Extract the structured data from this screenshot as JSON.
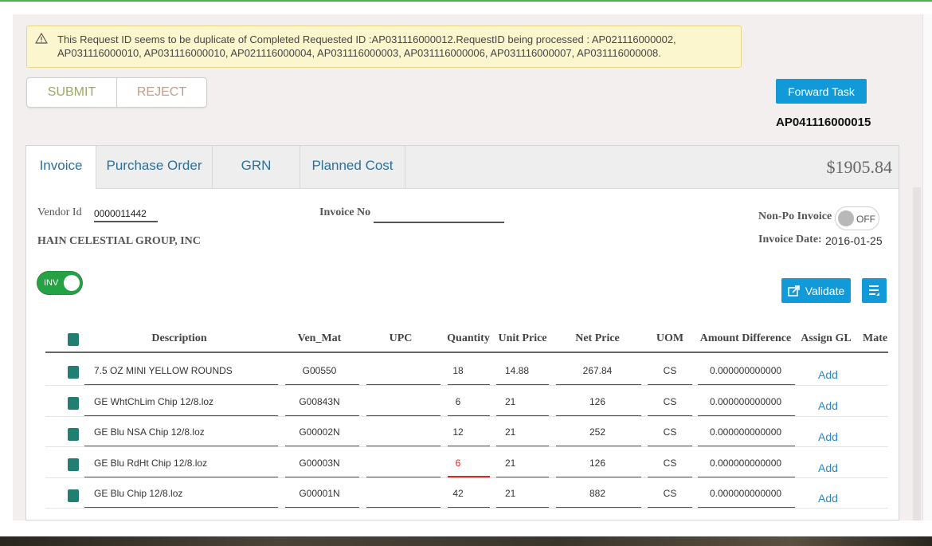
{
  "alert": {
    "icon": "warning-icon",
    "line1": "This Request ID seems to be duplicate of Completed Requested ID :AP031116000012.RequestID being processed : AP021116000002,",
    "line2": "AP031116000010, AP031116000010, AP021116000004, AP031116000003, AP031116000006, AP031116000007, AP031116000008."
  },
  "actions": {
    "submit": "SUBMIT",
    "reject": "REJECT",
    "forward": "Forward Task"
  },
  "request_id": "AP041116000015",
  "tabs": [
    {
      "label": "Invoice"
    },
    {
      "label": "Purchase Order"
    },
    {
      "label": "GRN"
    },
    {
      "label": "Planned Cost"
    }
  ],
  "total": "$1905.84",
  "invoice": {
    "vendor_id_label": "Vendor Id",
    "vendor_id": "0000011442",
    "invoice_no_label": "Invoice No",
    "vendor_name": "HAIN CELESTIAL GROUP, INC",
    "non_po_label": "Non-Po Invoice",
    "non_po_state": "OFF",
    "invoice_date_label": "Invoice Date:",
    "invoice_date": "2016-01-25",
    "inv_toggle": "INV",
    "validate": "Validate"
  },
  "table": {
    "headers": {
      "description": "Description",
      "ven_mat": "Ven_Mat",
      "upc": "UPC",
      "quantity": "Quantity",
      "unit_price": "Unit Price",
      "net_price": "Net Price",
      "uom": "UOM",
      "amount_difference": "Amount Difference",
      "assign_gl": "Assign GL",
      "mate": "Mate"
    },
    "rows": [
      {
        "description": "7.5 OZ MINI YELLOW ROUNDS",
        "ven_mat": "G00550",
        "upc": "",
        "quantity": "18",
        "unit_price": "14.88",
        "net_price": "267.84",
        "uom": "CS",
        "amount_difference": "0.000000000000",
        "assign_gl": "Add"
      },
      {
        "description": "GE WhtChLim Chip 12/8.loz",
        "ven_mat": "G00843N",
        "upc": "",
        "quantity": "6",
        "unit_price": "21",
        "net_price": "126",
        "uom": "CS",
        "amount_difference": "0.000000000000",
        "assign_gl": "Add"
      },
      {
        "description": "GE Blu NSA Chip 12/8.loz",
        "ven_mat": "G00002N",
        "upc": "",
        "quantity": "12",
        "unit_price": "21",
        "net_price": "252",
        "uom": "CS",
        "amount_difference": "0.000000000000",
        "assign_gl": "Add"
      },
      {
        "description": "GE Blu RdHt Chip 12/8.loz",
        "ven_mat": "G00003N",
        "upc": "",
        "quantity": "6",
        "unit_price": "21",
        "net_price": "126",
        "uom": "CS",
        "amount_difference": "0.000000000000",
        "assign_gl": "Add"
      },
      {
        "description": "GE Blu Chip 12/8.loz",
        "ven_mat": "G00001N",
        "upc": "",
        "quantity": "42",
        "unit_price": "21",
        "net_price": "882",
        "uom": "CS",
        "amount_difference": "0.000000000000",
        "assign_gl": "Add"
      }
    ]
  },
  "colors": {
    "primary": "#1199d8",
    "checkbox": "#217e72",
    "success": "#25a244",
    "error": "#e2231a",
    "alert_bg": "#fcf6ce"
  }
}
